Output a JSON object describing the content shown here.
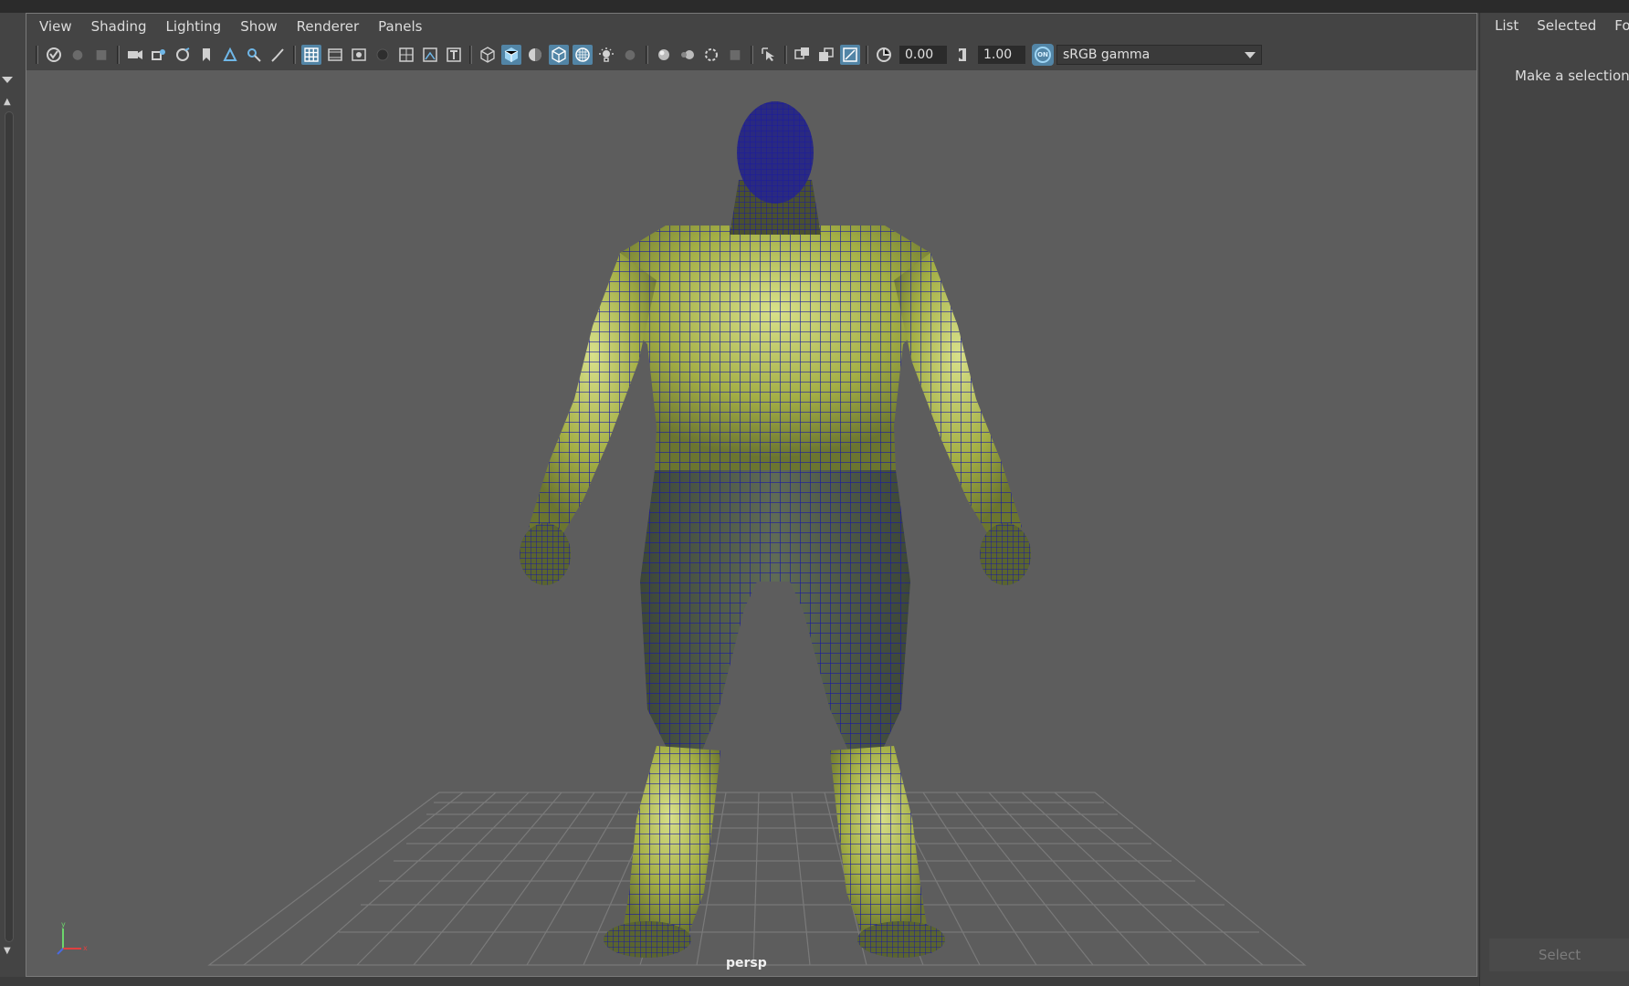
{
  "viewport_menu": [
    "View",
    "Shading",
    "Lighting",
    "Show",
    "Renderer",
    "Panels"
  ],
  "toolbar": {
    "exposure_value": "0.00",
    "gamma_value": "1.00",
    "gamma_toggle_label": "ON",
    "color_space": "sRGB gamma"
  },
  "viewport": {
    "camera_label": "persp",
    "axis_labels": {
      "y": "y",
      "x": "x"
    }
  },
  "right_panel": {
    "menu": [
      "List",
      "Selected",
      "Fo"
    ],
    "hint": "Make a selection",
    "select_button": "Select"
  },
  "colors": {
    "viewport_bg": "#5d5d5d",
    "accent": "#5285a6",
    "wireframe": "#1a1aa0",
    "skin": "#a8b44a",
    "pants": "#4f5a4a"
  }
}
